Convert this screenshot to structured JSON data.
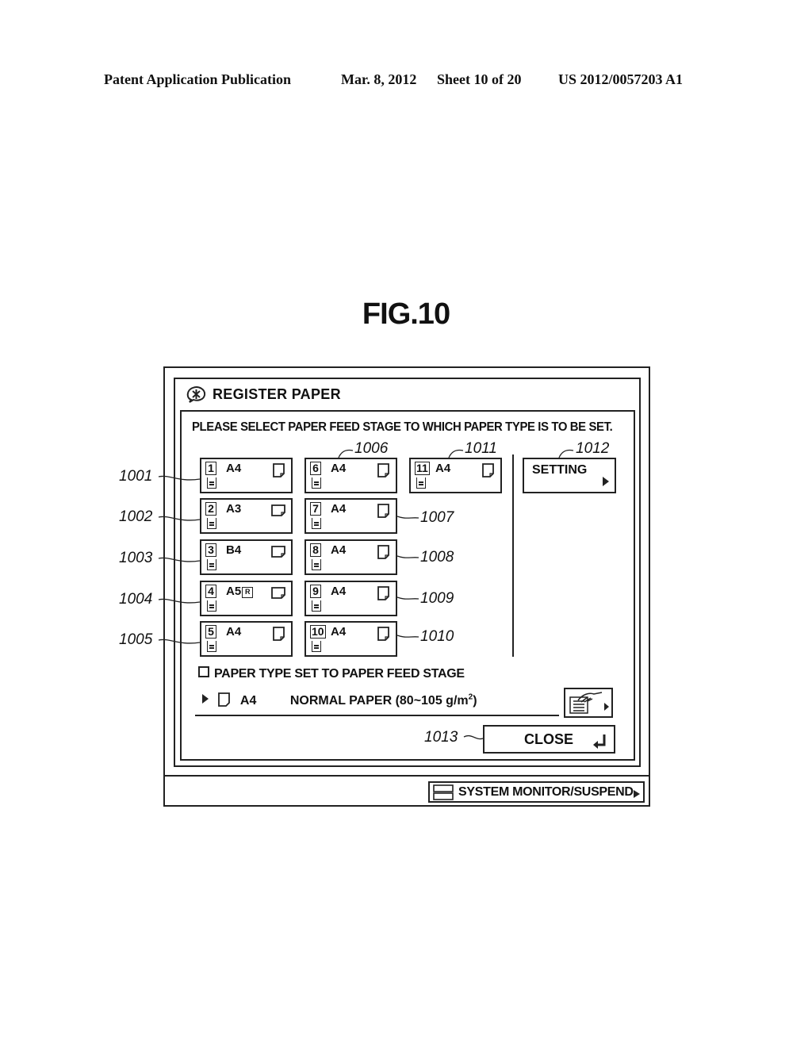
{
  "patent_header": {
    "publication": "Patent Application Publication",
    "date": "Mar. 8, 2012",
    "sheet": "Sheet 10 of 20",
    "number": "US 2012/0057203 A1"
  },
  "figure_label": "FIG.10",
  "dialog": {
    "title": "REGISTER PAPER",
    "title_icon": "paper-register-icon",
    "instruction": "PLEASE SELECT PAPER FEED STAGE TO WHICH PAPER TYPE IS TO BE SET.",
    "trays": [
      {
        "stage": "1",
        "size": "A4",
        "rotated": false,
        "orientation": "portrait",
        "ref": "1001"
      },
      {
        "stage": "2",
        "size": "A3",
        "rotated": false,
        "orientation": "landscape",
        "ref": "1002"
      },
      {
        "stage": "3",
        "size": "B4",
        "rotated": false,
        "orientation": "landscape",
        "ref": "1003"
      },
      {
        "stage": "4",
        "size": "A5",
        "rotated": true,
        "rotated_badge": "R",
        "orientation": "landscape",
        "ref": "1004"
      },
      {
        "stage": "5",
        "size": "A4",
        "rotated": false,
        "orientation": "portrait",
        "ref": "1005"
      },
      {
        "stage": "6",
        "size": "A4",
        "rotated": false,
        "orientation": "portrait",
        "ref": "1006"
      },
      {
        "stage": "7",
        "size": "A4",
        "rotated": false,
        "orientation": "portrait",
        "ref": "1007"
      },
      {
        "stage": "8",
        "size": "A4",
        "rotated": false,
        "orientation": "portrait",
        "ref": "1008"
      },
      {
        "stage": "9",
        "size": "A4",
        "rotated": false,
        "orientation": "portrait",
        "ref": "1009"
      },
      {
        "stage": "10",
        "size": "A4",
        "rotated": false,
        "orientation": "portrait",
        "ref": "1010"
      },
      {
        "stage": "11",
        "size": "A4",
        "rotated": false,
        "orientation": "portrait",
        "ref": "1011"
      }
    ],
    "setting_button": {
      "label": "SETTING",
      "ref": "1012"
    },
    "section_label": "PAPER TYPE SET TO PAPER FEED STAGE",
    "current": {
      "size": "A4",
      "paper_type": "NORMAL PAPER (80~105 g/m",
      "superscript": "2",
      "paper_type_end": ")"
    },
    "close_button": {
      "label": "CLOSE",
      "ref": "1013"
    }
  },
  "status_bar": {
    "system_monitor_label": "SYSTEM MONITOR/SUSPEND"
  }
}
